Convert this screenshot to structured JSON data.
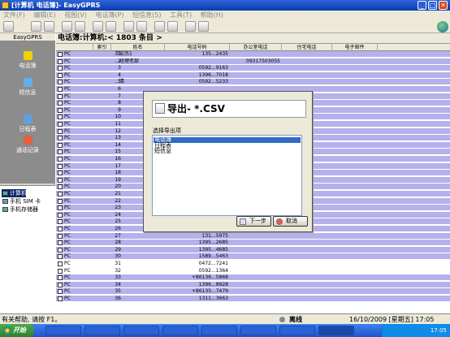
{
  "window": {
    "title": "[计算机 电话簿]- EasyGPRS",
    "minimize": "_",
    "maximize": "□",
    "close": "✕"
  },
  "menu": [
    "文件(F)",
    "编辑(E)",
    "视图(V)",
    "电话簿(P)",
    "短信息(S)",
    "工具(T)",
    "帮助(H)"
  ],
  "nav": {
    "header": "EasyGPRS",
    "items": [
      {
        "label": "电话簿",
        "icon": "phonebook-icon",
        "color": "#f0d000"
      },
      {
        "label": "短信息",
        "icon": "sms-icon",
        "color": "#60b0f0"
      },
      {
        "label": "日程表",
        "icon": "calendar-icon",
        "color": "#60a0e0"
      },
      {
        "label": "通话记录",
        "icon": "call-log-icon",
        "color": "#e06040"
      }
    ]
  },
  "tree": [
    {
      "label": "计算机",
      "selected": true
    },
    {
      "label": "手机 SIM 卡",
      "selected": false
    },
    {
      "label": "手机存储器",
      "selected": false
    }
  ],
  "list": {
    "title": "电话簿:计算机:< 1803 条目 >",
    "columns": [
      "索引",
      "姓名",
      "电话号码",
      "办公室电话",
      "住宅电话",
      "电子邮件"
    ],
    "rows": [
      {
        "mem": "PC",
        "idx": "1",
        "name": "王宏杰1",
        "phone": "135...2435",
        "office": ""
      },
      {
        "mem": "PC",
        "idx": "2",
        "name": "…经理老部",
        "phone": "",
        "office": "09317503055"
      },
      {
        "mem": "PC",
        "idx": "3",
        "name": "",
        "phone": "0592...9163",
        "office": ""
      },
      {
        "mem": "PC",
        "idx": "4",
        "name": "",
        "phone": "1396...7018",
        "office": ""
      },
      {
        "mem": "PC",
        "idx": "5",
        "name": "…清",
        "phone": "0592...5233",
        "office": ""
      },
      {
        "mem": "PC",
        "idx": "6",
        "name": "",
        "phone": "",
        "office": ""
      },
      {
        "mem": "PC",
        "idx": "7",
        "name": "",
        "phone": "",
        "office": ""
      },
      {
        "mem": "PC",
        "idx": "8",
        "name": "",
        "phone": "",
        "office": ""
      },
      {
        "mem": "PC",
        "idx": "9",
        "name": "",
        "phone": "",
        "office": ""
      },
      {
        "mem": "PC",
        "idx": "10",
        "name": "",
        "phone": "",
        "office": ""
      },
      {
        "mem": "PC",
        "idx": "11",
        "name": "",
        "phone": "",
        "office": ""
      },
      {
        "mem": "PC",
        "idx": "12",
        "name": "",
        "phone": "",
        "office": ""
      },
      {
        "mem": "PC",
        "idx": "13",
        "name": "",
        "phone": "",
        "office": ""
      },
      {
        "mem": "PC",
        "idx": "14",
        "name": "",
        "phone": "",
        "office": ""
      },
      {
        "mem": "PC",
        "idx": "15",
        "name": "",
        "phone": "",
        "office": ""
      },
      {
        "mem": "PC",
        "idx": "16",
        "name": "",
        "phone": "",
        "office": ""
      },
      {
        "mem": "PC",
        "idx": "17",
        "name": "",
        "phone": "",
        "office": ""
      },
      {
        "mem": "PC",
        "idx": "18",
        "name": "",
        "phone": "",
        "office": ""
      },
      {
        "mem": "PC",
        "idx": "19",
        "name": "",
        "phone": "",
        "office": ""
      },
      {
        "mem": "PC",
        "idx": "20",
        "name": "",
        "phone": "",
        "office": ""
      },
      {
        "mem": "PC",
        "idx": "21",
        "name": "",
        "phone": "",
        "office": ""
      },
      {
        "mem": "PC",
        "idx": "22",
        "name": "",
        "phone": "",
        "office": ""
      },
      {
        "mem": "PC",
        "idx": "23",
        "name": "",
        "phone": "",
        "office": ""
      },
      {
        "mem": "PC",
        "idx": "24",
        "name": "",
        "phone": "",
        "office": ""
      },
      {
        "mem": "PC",
        "idx": "25",
        "name": "",
        "phone": "",
        "office": ""
      },
      {
        "mem": "PC",
        "idx": "26",
        "name": "",
        "phone": "1580...0098",
        "office": ""
      },
      {
        "mem": "PC",
        "idx": "27",
        "name": "",
        "phone": "131...5975",
        "office": ""
      },
      {
        "mem": "PC",
        "idx": "28",
        "name": "",
        "phone": "1395...2685",
        "office": ""
      },
      {
        "mem": "PC",
        "idx": "29",
        "name": "",
        "phone": "1395...4685",
        "office": ""
      },
      {
        "mem": "PC",
        "idx": "30",
        "name": "",
        "phone": "1589...5463",
        "office": ""
      },
      {
        "mem": "PC",
        "idx": "31",
        "name": "",
        "phone": "0472...7241",
        "office": ""
      },
      {
        "mem": "PC",
        "idx": "32",
        "name": "",
        "phone": "0592...1364",
        "office": ""
      },
      {
        "mem": "PC",
        "idx": "33",
        "name": "",
        "phone": "+86136...5868",
        "office": ""
      },
      {
        "mem": "PC",
        "idx": "34",
        "name": "",
        "phone": "1396...8928",
        "office": ""
      },
      {
        "mem": "PC",
        "idx": "35",
        "name": "",
        "phone": "+86135...7479",
        "office": ""
      },
      {
        "mem": "PC",
        "idx": "36",
        "name": "",
        "phone": "1311...3663",
        "office": ""
      }
    ]
  },
  "dialog": {
    "title": "导出- *.CSV",
    "section_label": "选择导出项",
    "options": [
      "电话簿",
      "日程表",
      "短信息"
    ],
    "selected_index": 0,
    "next_button": "下一步",
    "cancel_button": "取消"
  },
  "status": {
    "help": "有关帮助, 请按 F1。",
    "connection": "离线",
    "date": "16/10/2009 [星期五] 17:05"
  },
  "taskbar": {
    "start": "开始",
    "clock": "17:05"
  },
  "colors": {
    "row_alt": "#b5b1ec",
    "selection": "#316ac5",
    "titlebar": "#0a3bb0"
  }
}
